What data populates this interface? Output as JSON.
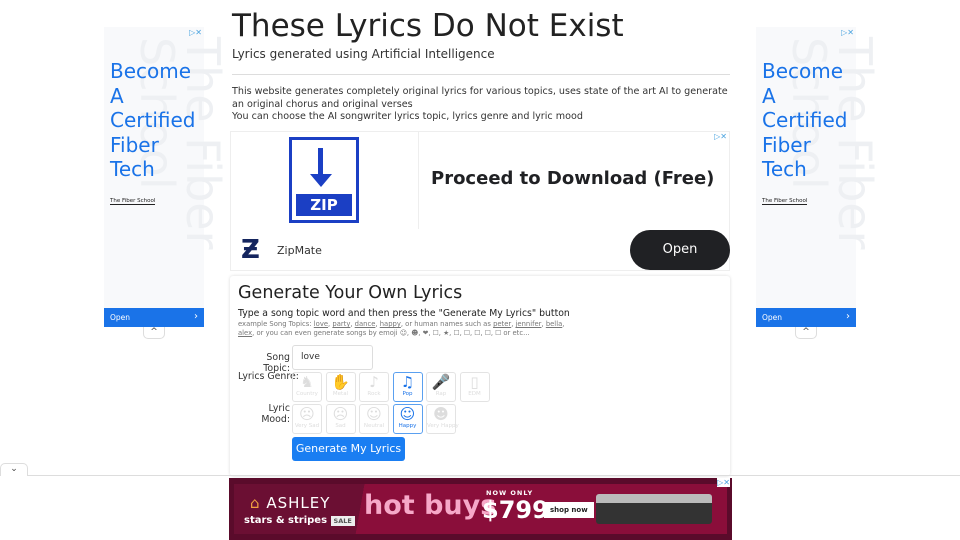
{
  "header": {
    "title": "These Lyrics Do Not Exist",
    "subtitle": "Lyrics generated using Artificial Intelligence"
  },
  "intro": {
    "line1": "This website generates completely original lyrics for various topics, uses state of the art AI to generate an original chorus and original verses",
    "line2": "You can choose the AI songwriter lyrics topic, lyrics genre and lyric mood"
  },
  "side_ad": {
    "headline": "Become A Certified Fiber Tech",
    "watermark": "The Fiber School",
    "advertiser": "The Fiber School",
    "open": "Open",
    "chevron": "›",
    "collapse": "^"
  },
  "top_ad": {
    "headline": "Proceed to Download (Free)",
    "file_label": "ZIP",
    "brand": "ZipMate",
    "open": "Open"
  },
  "form": {
    "title": "Generate Your Own Lyrics",
    "instruction": "Type a song topic word and then press the \"Generate My Lyrics\" button",
    "example_prefix": "example Song Topics:",
    "example_topics": [
      "love",
      "party",
      "dance",
      "happy"
    ],
    "names_prefix": ", or human names such as",
    "example_names": [
      "peter",
      "jennifer",
      "bella",
      "alex"
    ],
    "emoji_text": ", or you can even generate songs by emoji ☺, ☻, ❤, ☐, ★, ☐, ☐, ☐, ☐, ☐ or etc...",
    "topic_label": "Song Topic:",
    "topic_value": "love",
    "genre_label": "Lyrics Genre:",
    "genres": [
      {
        "label": "Country",
        "icon": "horse-rider-icon",
        "glyph": "♞"
      },
      {
        "label": "Metal",
        "icon": "rock-hand-icon",
        "glyph": "✋"
      },
      {
        "label": "Rock",
        "icon": "guitar-icon",
        "glyph": "♪"
      },
      {
        "label": "Pop",
        "icon": "music-notes-icon",
        "glyph": "♫"
      },
      {
        "label": "Rap",
        "icon": "microphone-icon",
        "glyph": "🎤"
      },
      {
        "label": "EDM",
        "icon": "speaker-icon",
        "glyph": "▯"
      }
    ],
    "selected_genre": "Pop",
    "mood_label": "Lyric Mood:",
    "moods": [
      {
        "label": "Very Sad",
        "icon": "very-sad-face-icon",
        "glyph": "☹"
      },
      {
        "label": "Sad",
        "icon": "sad-face-icon",
        "glyph": "☹"
      },
      {
        "label": "Neutral",
        "icon": "neutral-face-icon",
        "glyph": "☺"
      },
      {
        "label": "Happy",
        "icon": "happy-face-icon",
        "glyph": "☺"
      },
      {
        "label": "Very Happy",
        "icon": "very-happy-face-icon",
        "glyph": "☻"
      }
    ],
    "selected_mood": "Happy",
    "submit": "Generate My Lyrics"
  },
  "bottom_ad": {
    "brand": "ASHLEY",
    "tagline": "stars & stripes",
    "badge": "SALE",
    "headline": "hot buys",
    "price_prefix": "NOW ONLY",
    "price": "$799",
    "cta": "shop now"
  },
  "colors": {
    "accent": "#1a73e8",
    "button": "#1a7ef2",
    "ad_bg": "#8a0e3a"
  }
}
